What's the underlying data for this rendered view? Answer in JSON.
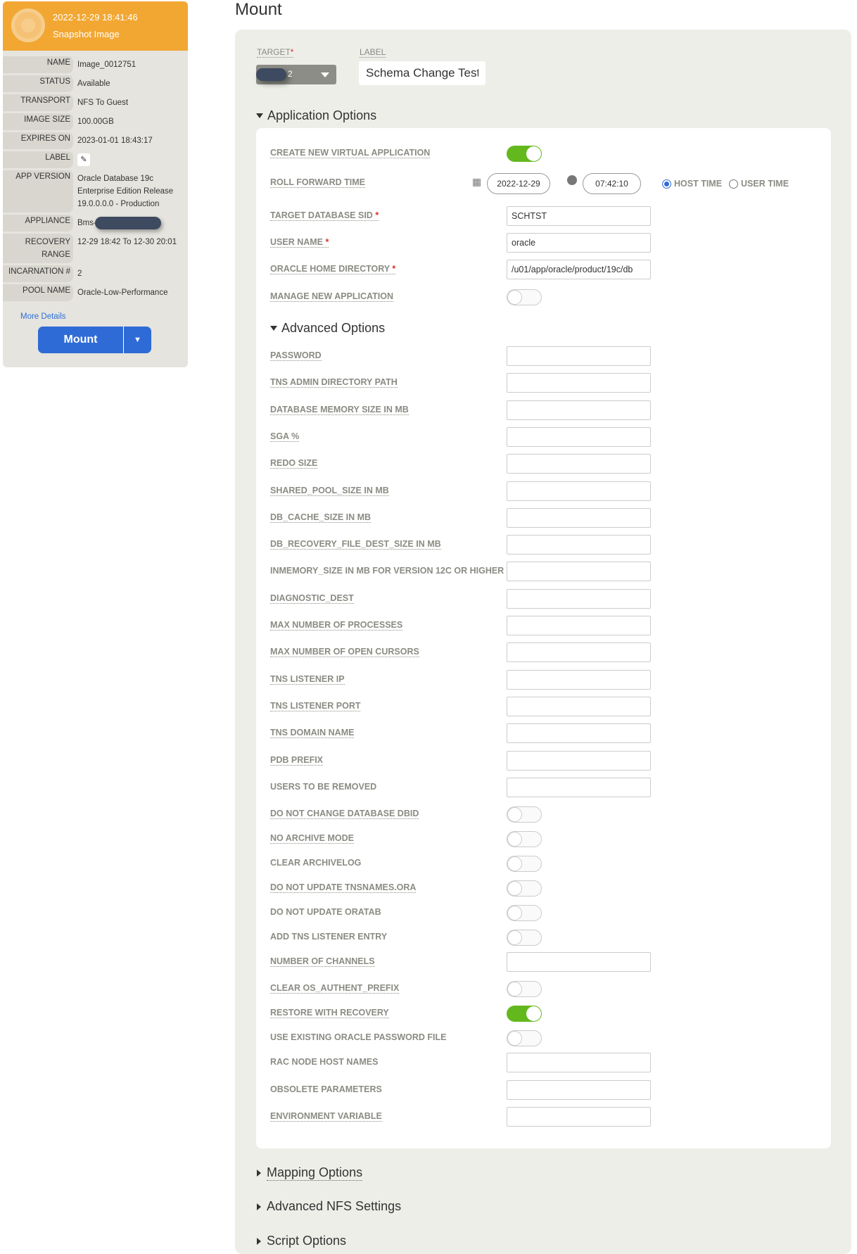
{
  "sidebar": {
    "timestamp": "2022-12-29  18:41:46",
    "image_type": "Snapshot Image",
    "rows": [
      {
        "key": "NAME",
        "value": "Image_0012751"
      },
      {
        "key": "STATUS",
        "value": "Available"
      },
      {
        "key": "TRANSPORT",
        "value": "NFS To Guest"
      },
      {
        "key": "IMAGE SIZE",
        "value": "100.00GB"
      },
      {
        "key": "EXPIRES ON",
        "value": "2023-01-01 18:43:17"
      },
      {
        "key": "LABEL",
        "value": ""
      },
      {
        "key": "APP VERSION",
        "value": "Oracle Database 19c Enterprise Edition Release 19.0.0.0.0 - Production"
      },
      {
        "key": "APPLIANCE",
        "value": "Bms-"
      },
      {
        "key": "RECOVERY RANGE",
        "value": "12-29 18:42 To 12-30 20:01"
      },
      {
        "key": "INCARNATION #",
        "value": "2"
      },
      {
        "key": "POOL NAME",
        "value": "Oracle-Low-Performance"
      }
    ],
    "more_details": "More Details",
    "mount_label": "Mount"
  },
  "main": {
    "title": "Mount",
    "target_label": "TARGET",
    "target_value": "2",
    "label_label": "LABEL",
    "label_value": "Schema Change Test",
    "app_options": "Application Options",
    "create_new_virtual_app": {
      "label": "CREATE NEW VIRTUAL APPLICATION",
      "on": true
    },
    "roll_forward": {
      "label": "ROLL FORWARD TIME",
      "date": "2022-12-29",
      "time": "07:42:10",
      "host_time": "HOST TIME",
      "user_time": "USER TIME",
      "selected": "HOST TIME"
    },
    "target_sid": {
      "label": "TARGET DATABASE SID",
      "value": "SCHTST"
    },
    "user_name": {
      "label": "USER NAME",
      "value": "oracle"
    },
    "oracle_home": {
      "label": "ORACLE HOME DIRECTORY",
      "value": "/u01/app/oracle/product/19c/db"
    },
    "manage_new_app": {
      "label": "MANAGE NEW APPLICATION",
      "on": false
    },
    "advanced_options": "Advanced Options",
    "advanced_fields": [
      {
        "label": "PASSWORD",
        "type": "input",
        "value": ""
      },
      {
        "label": "TNS ADMIN DIRECTORY PATH",
        "type": "input",
        "value": ""
      },
      {
        "label": "DATABASE MEMORY SIZE IN MB",
        "type": "input",
        "value": ""
      },
      {
        "label": "SGA %",
        "type": "input",
        "value": ""
      },
      {
        "label": "REDO SIZE",
        "type": "input",
        "value": ""
      },
      {
        "label": "SHARED_POOL_SIZE IN MB",
        "type": "input",
        "value": ""
      },
      {
        "label": "DB_CACHE_SIZE IN MB",
        "type": "input",
        "value": ""
      },
      {
        "label": "DB_RECOVERY_FILE_DEST_SIZE IN MB",
        "type": "input",
        "value": ""
      },
      {
        "label": "INMEMORY_SIZE IN MB FOR VERSION 12C OR HIGHER",
        "type": "input",
        "value": ""
      },
      {
        "label": "DIAGNOSTIC_DEST",
        "type": "input",
        "value": ""
      },
      {
        "label": "MAX NUMBER OF PROCESSES",
        "type": "input",
        "value": ""
      },
      {
        "label": "MAX NUMBER OF OPEN CURSORS",
        "type": "input",
        "value": ""
      },
      {
        "label": "TNS LISTENER IP",
        "type": "input",
        "value": ""
      },
      {
        "label": "TNS LISTENER PORT",
        "type": "input",
        "value": ""
      },
      {
        "label": "TNS DOMAIN NAME",
        "type": "input",
        "value": ""
      },
      {
        "label": "PDB PREFIX",
        "type": "input",
        "value": ""
      },
      {
        "label": "USERS TO BE REMOVED",
        "type": "input",
        "value": ""
      },
      {
        "label": "DO NOT CHANGE DATABASE DBID",
        "type": "toggle",
        "on": false
      },
      {
        "label": "NO ARCHIVE MODE",
        "type": "toggle",
        "on": false
      },
      {
        "label": "CLEAR ARCHIVELOG",
        "type": "toggle",
        "on": false
      },
      {
        "label": "DO NOT UPDATE TNSNAMES.ORA",
        "type": "toggle",
        "on": false
      },
      {
        "label": "DO NOT UPDATE ORATAB",
        "type": "toggle",
        "on": false
      },
      {
        "label": "ADD TNS LISTENER ENTRY",
        "type": "toggle",
        "on": false
      },
      {
        "label": "NUMBER OF CHANNELS",
        "type": "input",
        "value": ""
      },
      {
        "label": "CLEAR OS_AUTHENT_PREFIX",
        "type": "toggle",
        "on": false
      },
      {
        "label": "RESTORE WITH RECOVERY",
        "type": "toggle",
        "on": true
      },
      {
        "label": "USE EXISTING ORACLE PASSWORD FILE",
        "type": "toggle",
        "on": false
      },
      {
        "label": "RAC NODE HOST NAMES",
        "type": "input",
        "value": ""
      },
      {
        "label": "OBSOLETE PARAMETERS",
        "type": "input",
        "value": ""
      },
      {
        "label": "ENVIRONMENT VARIABLE",
        "type": "input",
        "value": ""
      }
    ],
    "collapsed_sections": [
      "Mapping Options",
      "Advanced NFS Settings",
      "Script Options"
    ]
  }
}
